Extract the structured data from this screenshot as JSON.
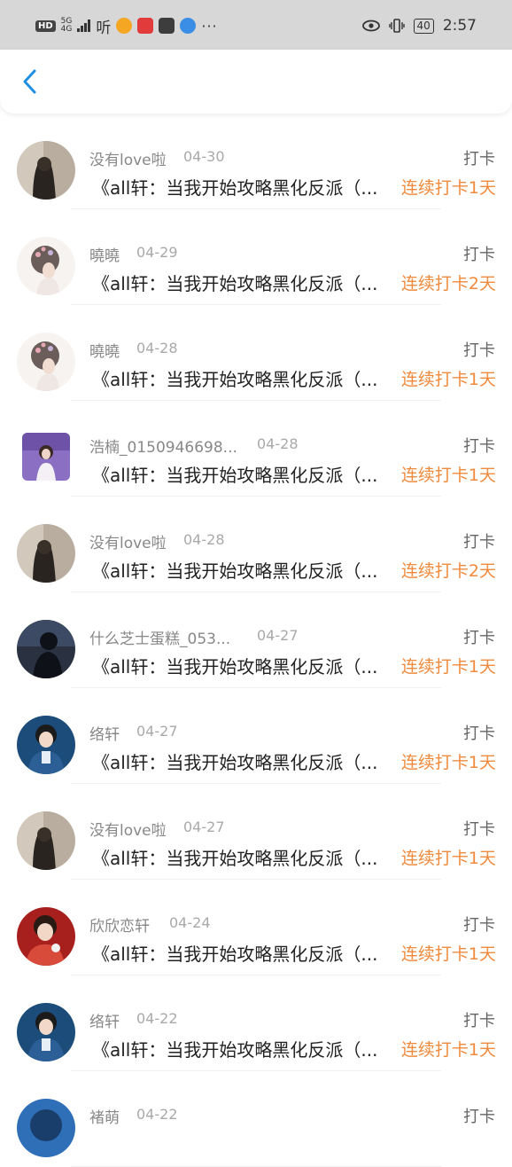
{
  "statusbar": {
    "hd": "HD",
    "signal_top": "5G",
    "signal_bottom": "4G",
    "listen_text": "听",
    "battery": "40",
    "time": "2:57"
  },
  "colors": {
    "accent_blue": "#1e8fe1",
    "streak_orange": "#f08a3c"
  },
  "feed": [
    {
      "user": "没有love啦",
      "date": "04-30",
      "tag": "打卡",
      "book": "《all轩：当我开始攻略黑化反派（...",
      "streak": "连续打卡1天"
    },
    {
      "user": "曉曉",
      "date": "04-29",
      "tag": "打卡",
      "book": "《all轩：当我开始攻略黑化反派（...",
      "streak": "连续打卡2天"
    },
    {
      "user": "曉曉",
      "date": "04-28",
      "tag": "打卡",
      "book": "《all轩：当我开始攻略黑化反派（...",
      "streak": "连续打卡1天"
    },
    {
      "user": "浩楠_0150946698...",
      "date": "04-28",
      "tag": "打卡",
      "book": "《all轩：当我开始攻略黑化反派（...",
      "streak": "连续打卡1天"
    },
    {
      "user": "没有love啦",
      "date": "04-28",
      "tag": "打卡",
      "book": "《all轩：当我开始攻略黑化反派（...",
      "streak": "连续打卡2天"
    },
    {
      "user": "什么芝士蛋糕_053...",
      "date": "04-27",
      "tag": "打卡",
      "book": "《all轩：当我开始攻略黑化反派（...",
      "streak": "连续打卡1天"
    },
    {
      "user": "络轩",
      "date": "04-27",
      "tag": "打卡",
      "book": "《all轩：当我开始攻略黑化反派（...",
      "streak": "连续打卡1天"
    },
    {
      "user": "没有love啦",
      "date": "04-27",
      "tag": "打卡",
      "book": "《all轩：当我开始攻略黑化反派（...",
      "streak": "连续打卡1天"
    },
    {
      "user": "欣欣恋轩",
      "date": "04-24",
      "tag": "打卡",
      "book": "《all轩：当我开始攻略黑化反派（...",
      "streak": "连续打卡1天"
    },
    {
      "user": "络轩",
      "date": "04-22",
      "tag": "打卡",
      "book": "《all轩：当我开始攻略黑化反派（...",
      "streak": "连续打卡1天"
    },
    {
      "user": "褚萌",
      "date": "04-22",
      "tag": "打卡",
      "book": "",
      "streak": ""
    }
  ]
}
